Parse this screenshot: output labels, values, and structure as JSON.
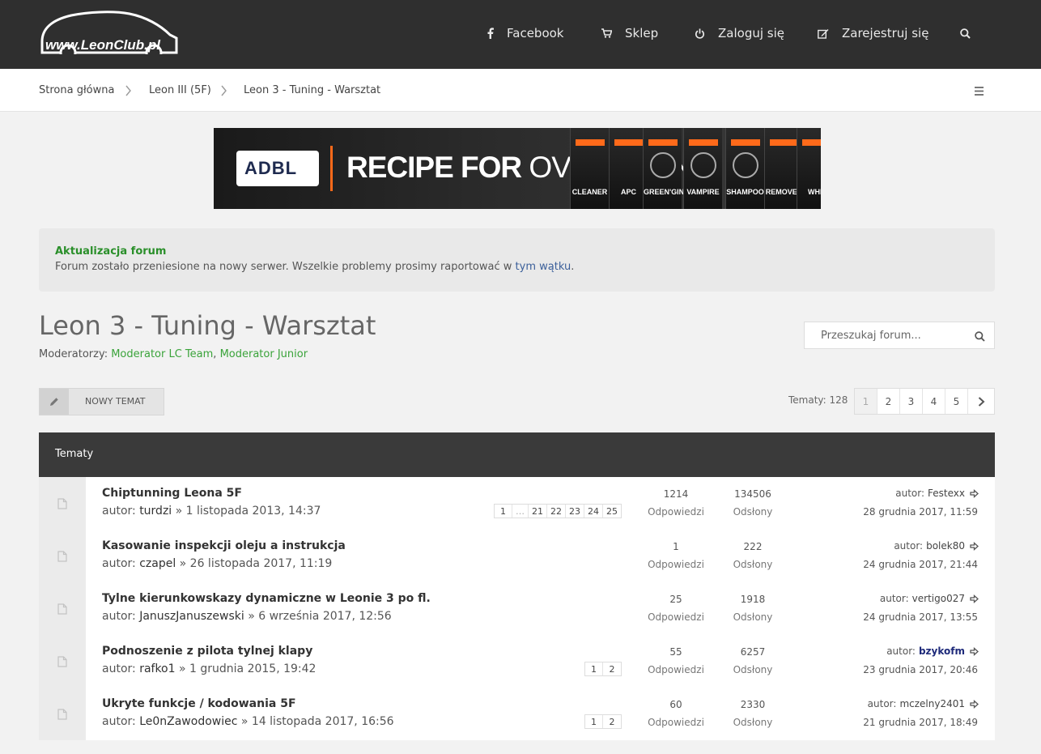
{
  "header": {
    "logo_text": "www.LeonClub.pl",
    "nav": [
      {
        "label": "Facebook",
        "icon": "facebook-icon"
      },
      {
        "label": "Sklep",
        "icon": "cart-icon"
      },
      {
        "label": "Zaloguj się",
        "icon": "power-icon"
      },
      {
        "label": "Zarejestruj się",
        "icon": "edit-icon"
      }
    ]
  },
  "breadcrumb": [
    "Strona główna",
    "Leon III (5F)",
    "Leon 3 - Tuning - Warsztat"
  ],
  "ad": {
    "brand": "ADBL",
    "headline_bold": "RECIPE FOR",
    "headline_light": "OVERTAKING",
    "products": [
      "CLEANER",
      "APC",
      "GREEN'GINE",
      "VAMPIRE",
      "SHAMPOO",
      "REMOVER",
      "WHE"
    ],
    "accent": "#ff6a1a"
  },
  "notice": {
    "title": "Aktualizacja forum",
    "text": "Forum zostało przeniesione na nowy serwer. Wszelkie problemy prosimy raportować w",
    "link": "tym wątku",
    "tail": "."
  },
  "forum": {
    "title": "Leon 3 - Tuning - Warsztat",
    "moderators_label": "Moderatorzy:",
    "moderators": [
      "Moderator LC Team",
      "Moderator Junior"
    ],
    "search_placeholder": "Przeszukaj forum...",
    "new_topic_label": "NOWY TEMAT",
    "topic_count": "Tematy: 128",
    "pages": [
      "1",
      "2",
      "3",
      "4",
      "5"
    ],
    "current_page": "1"
  },
  "topics": {
    "header": "Tematy",
    "replies_label": "Odpowiedzi",
    "views_label": "Odsłony",
    "author_label": "autor:",
    "rows": [
      {
        "title": "Chiptunning Leona 5F",
        "author": "turdzi",
        "date": "» 1 listopada 2013, 14:37",
        "pages": [
          "1",
          "…",
          "21",
          "22",
          "23",
          "24",
          "25"
        ],
        "replies": "1214",
        "views": "134506",
        "last_author": "Festexx",
        "last_date": "28 grudnia 2017, 11:59",
        "highlight": false
      },
      {
        "title": "Kasowanie inspekcji oleju a instrukcja",
        "author": "czapel",
        "date": "» 26 listopada 2017, 11:19",
        "pages": [],
        "replies": "1",
        "views": "222",
        "last_author": "bolek80",
        "last_date": "24 grudnia 2017, 21:44",
        "highlight": false
      },
      {
        "title": "Tylne kierunkowskazy dynamiczne w Leonie 3 po fl.",
        "author": "JanuszJanuszewski",
        "date": "» 6 września 2017, 12:56",
        "pages": [],
        "replies": "25",
        "views": "1918",
        "last_author": "vertigo027",
        "last_date": "24 grudnia 2017, 13:55",
        "highlight": false
      },
      {
        "title": "Podnoszenie z pilota tylnej klapy",
        "author": "rafko1",
        "date": "» 1 grudnia 2015, 19:42",
        "pages": [
          "1",
          "2"
        ],
        "replies": "55",
        "views": "6257",
        "last_author": "bzykofm",
        "last_date": "23 grudnia 2017, 20:46",
        "highlight": true
      },
      {
        "title": "Ukryte funkcje / kodowania 5F",
        "author": "Le0nZawodowiec",
        "date": "» 14 listopada 2017, 16:56",
        "pages": [
          "1",
          "2"
        ],
        "replies": "60",
        "views": "2330",
        "last_author": "mczelny2401",
        "last_date": "21 grudnia 2017, 18:49",
        "highlight": false
      }
    ]
  }
}
